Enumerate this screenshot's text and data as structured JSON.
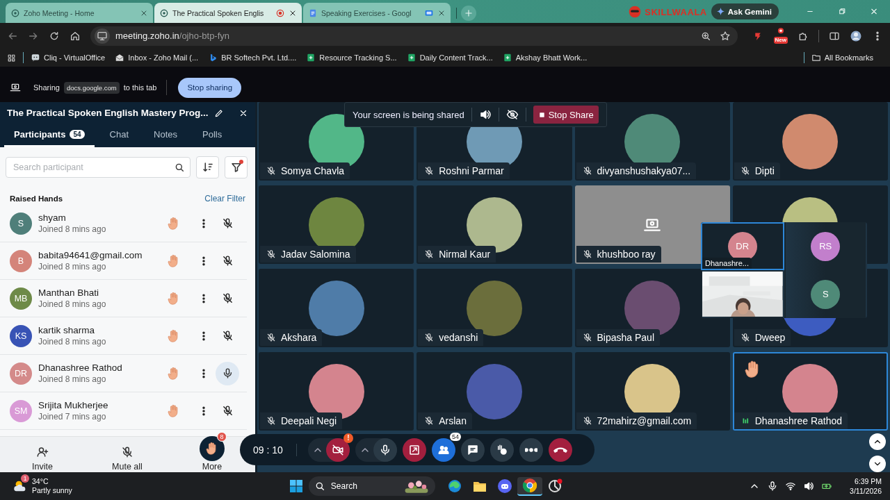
{
  "browser": {
    "tabs": [
      {
        "title": "Zoho Meeting - Home",
        "selected": false,
        "recording": false,
        "casting": false
      },
      {
        "title": "The Practical Spoken Englis",
        "selected": true,
        "recording": true,
        "casting": false
      },
      {
        "title": "Speaking Exercises - Googl",
        "selected": false,
        "recording": false,
        "casting": true
      }
    ],
    "brand": "SKILLWAALA",
    "gemini": "Ask Gemini",
    "address": {
      "host": "meeting.zoho.in",
      "path": "/ojho-btp-fyn"
    },
    "extension_badge": "New",
    "bookmarks": [
      {
        "label": "Cliq - VirtualOffice"
      },
      {
        "label": "Inbox - Zoho Mail (..."
      },
      {
        "label": "BR Softech Pvt. Ltd...."
      },
      {
        "label": "Resource Tracking S..."
      },
      {
        "label": "Daily Content Track..."
      },
      {
        "label": "Akshay Bhatt Work..."
      }
    ],
    "all_bookmarks": "All Bookmarks"
  },
  "share_bar": {
    "label": "Sharing",
    "source": "docs.google.com",
    "suffix": "to this tab",
    "button": "Stop sharing"
  },
  "panel": {
    "title": "The Practical Spoken English Mastery Prog...",
    "tabs": [
      {
        "label": "Participants",
        "count": "54",
        "selected": true
      },
      {
        "label": "Chat",
        "selected": false
      },
      {
        "label": "Notes",
        "selected": false
      },
      {
        "label": "Polls",
        "selected": false
      }
    ],
    "search_placeholder": "Search participant",
    "filter_active": true,
    "section": "Raised Hands",
    "clear_filter": "Clear Filter",
    "participants": [
      {
        "initials": "S",
        "name": "shyam",
        "joined": "Joined 8 mins ago",
        "color": "#4f7f7a",
        "hand_raised": true,
        "muted": true
      },
      {
        "initials": "B",
        "name": "babita94641@gmail.com",
        "joined": "Joined 8 mins ago",
        "color": "#d4847a",
        "hand_raised": true,
        "muted": true
      },
      {
        "initials": "MB",
        "name": "Manthan Bhati",
        "joined": "Joined 8 mins ago",
        "color": "#6e8a48",
        "hand_raised": true,
        "muted": true
      },
      {
        "initials": "KS",
        "name": "kartik sharma",
        "joined": "Joined 8 mins ago",
        "color": "#3853b5",
        "hand_raised": true,
        "muted": true
      },
      {
        "initials": "DR",
        "name": "Dhanashree Rathod",
        "joined": "Joined 8 mins ago",
        "color": "#d48a8a",
        "hand_raised": true,
        "muted": false
      },
      {
        "initials": "SM",
        "name": "Srijita Mukherjee",
        "joined": "Joined 7 mins ago",
        "color": "#d99ad6",
        "hand_raised": true,
        "muted": true
      }
    ],
    "footer": [
      {
        "kind": "invite",
        "label": "Invite"
      },
      {
        "kind": "mute",
        "label": "Mute all"
      },
      {
        "kind": "hands",
        "label": "More",
        "badge": "8"
      }
    ]
  },
  "banner": {
    "text": "Your screen is being shared",
    "button": "Stop Share"
  },
  "grid": {
    "tiles": [
      {
        "kind": "avatar",
        "name": "Somya Chavla",
        "color": "#52b788",
        "muted": true,
        "selected": false,
        "hand_raised": false
      },
      {
        "kind": "avatar",
        "name": "Roshni Parmar",
        "color": "#6f9ab5",
        "muted": true,
        "selected": false,
        "hand_raised": false
      },
      {
        "kind": "avatar",
        "name": "divyanshushakya07...",
        "color": "#4f8a78",
        "muted": true,
        "selected": false,
        "hand_raised": false
      },
      {
        "kind": "avatar",
        "name": "Dipti",
        "color": "#d08a6e",
        "muted": true,
        "selected": false,
        "hand_raised": false
      },
      {
        "kind": "avatar",
        "name": "Jadav Salomina",
        "color": "#6e8640",
        "muted": true,
        "selected": false,
        "hand_raised": false
      },
      {
        "kind": "avatar",
        "name": "Nirmal Kaur",
        "color": "#adb88e",
        "muted": true,
        "selected": false,
        "hand_raised": false
      },
      {
        "kind": "camera",
        "name": "khushboo ray",
        "muted": true,
        "selected": false,
        "hand_raised": false
      },
      {
        "kind": "avatar",
        "color": "#b9bf82",
        "selected": false,
        "hand_raised": false
      },
      {
        "kind": "avatar",
        "name": "Akshara",
        "color": "#4f7ca8",
        "muted": true,
        "selected": false,
        "hand_raised": false
      },
      {
        "kind": "avatar",
        "name": "vedanshi",
        "color": "#6b6e3c",
        "muted": true,
        "selected": false,
        "hand_raised": false
      },
      {
        "kind": "avatar",
        "name": "Bipasha Paul",
        "color": "#6a4d70",
        "muted": true,
        "selected": false,
        "hand_raised": false
      },
      {
        "kind": "avatar",
        "name": "Dweep",
        "color": "#3d5cc0",
        "muted": true,
        "selected": false,
        "hand_raised": false
      },
      {
        "kind": "avatar",
        "name": "Deepali Negi",
        "color": "#d4848e",
        "muted": true,
        "selected": false,
        "hand_raised": false
      },
      {
        "kind": "avatar",
        "name": "Arslan",
        "color": "#4a5aa8",
        "muted": true,
        "selected": false,
        "hand_raised": false
      },
      {
        "kind": "avatar",
        "name": "72mahirz@gmail.com",
        "color": "#d9c48a",
        "muted": true,
        "selected": false,
        "hand_raised": false
      },
      {
        "kind": "avatar",
        "name": "Dhanashree Rathod",
        "color": "#d4848e",
        "muted": false,
        "selected": true,
        "hand_raised": true
      }
    ]
  },
  "mini_grid": {
    "tiles": [
      {
        "kind": "avatar",
        "initials": "DR",
        "color": "#d4848e",
        "name": "Dhanashre...",
        "selected": true
      },
      {
        "kind": "avatar",
        "initials": "RS",
        "color": "#c27fcc",
        "selected": false
      },
      {
        "kind": "picture",
        "selected": false
      },
      {
        "kind": "avatar",
        "initials": "S",
        "color": "#4f8a78",
        "selected": false
      }
    ]
  },
  "controls": {
    "timer": "09 : 10",
    "buttons": [
      {
        "kind": "video",
        "menu": true,
        "alert": "!"
      },
      {
        "kind": "mic",
        "menu": true
      },
      {
        "kind": "share",
        "menu": false
      },
      {
        "kind": "people",
        "menu": false,
        "badge": "54"
      },
      {
        "kind": "chat",
        "menu": false
      },
      {
        "kind": "reactions",
        "menu": false
      },
      {
        "kind": "more",
        "menu": false
      },
      {
        "kind": "leave",
        "menu": false
      }
    ]
  },
  "taskbar": {
    "weather": {
      "badge": "1",
      "temp": "34°C",
      "desc": "Partly sunny"
    },
    "search": "Search",
    "time": "6:39 PM",
    "date": "3/11/2026"
  }
}
